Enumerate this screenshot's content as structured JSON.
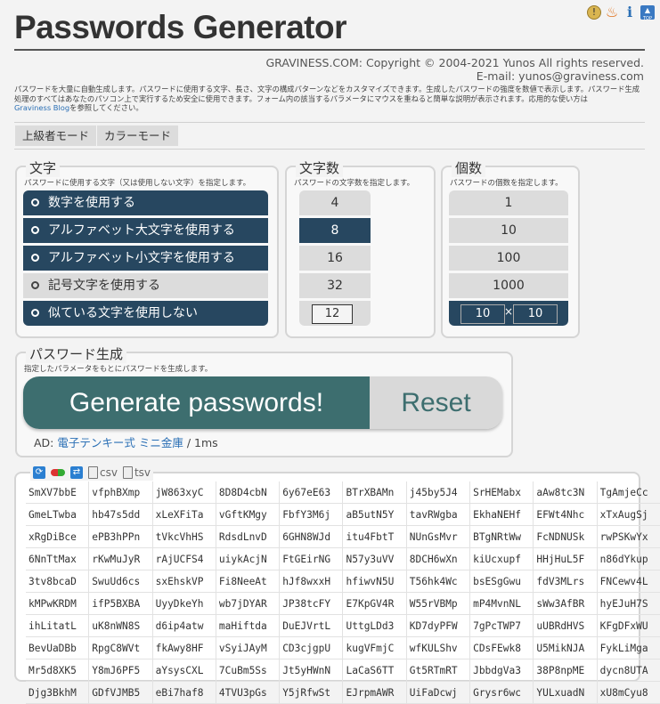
{
  "header": {
    "title": "Passwords Generator",
    "copyright": "GRAVINESS.COM: Copyright © 2004-2021 Yunos All rights reserved.",
    "email": "E-mail: yunos@graviness.com",
    "icons": [
      "warning-icon",
      "fire-icon",
      "info-icon",
      "top-icon"
    ],
    "top_icon_label": "TOP"
  },
  "description": {
    "text": "パスワードを大量に自動生成します。パスワードに使用する文字、長さ、文字の構成パターンなどをカスタマイズできます。生成したパスワードの強度を数値で表示します。パスワード生成処理のすべてはあなたのパソコン上で実行するため安全に使用できます。フォーム内の該当するパラメータにマウスを重ねると簡単な説明が表示されます。応用的な使い方は",
    "link": "Graviness Blog",
    "text_after": "を参照してください。"
  },
  "modes": [
    "上級者モード",
    "カラーモード"
  ],
  "chars_panel": {
    "legend": "文字",
    "sub": "パスワードに使用する文字（又は使用しない文字）を指定します。",
    "options": [
      {
        "label": "数字を使用する",
        "on": true
      },
      {
        "label": "アルファベット大文字を使用する",
        "on": true
      },
      {
        "label": "アルファベット小文字を使用する",
        "on": true
      },
      {
        "label": "記号文字を使用する",
        "on": false
      },
      {
        "label": "似ている文字を使用しない",
        "on": true
      }
    ]
  },
  "length_panel": {
    "legend": "文字数",
    "sub": "パスワードの文字数を指定します。",
    "options": [
      "4",
      "8",
      "16",
      "32"
    ],
    "selected": "8",
    "custom": "12"
  },
  "count_panel": {
    "legend": "個数",
    "sub": "パスワードの個数を指定します。",
    "options": [
      "1",
      "10",
      "100",
      "1000"
    ],
    "custom_a": "10",
    "times": "×",
    "custom_b": "10"
  },
  "generate_panel": {
    "legend": "パスワード生成",
    "sub": "指定したパラメータをもとにパスワードを生成します。",
    "generate_label": "Generate passwords!",
    "reset_label": "Reset"
  },
  "ad": {
    "prefix": "AD: ",
    "link": "電子テンキー式 ミニ金庫",
    "suffix": " / 1ms"
  },
  "results": {
    "tools": {
      "csv": "csv",
      "tsv": "tsv"
    },
    "passwords": [
      [
        "SmXV7bbE",
        "vfphBXmp",
        "jW863xyC",
        "8D8D4cbN",
        "6y67eE63",
        "BTrXBAMn",
        "j45by5J4",
        "SrHEMabx",
        "aAw8tc3N",
        "TgAmjeCc"
      ],
      [
        "GmeLTwba",
        "hb47s5dd",
        "xLeXFiTa",
        "vGftKMgy",
        "FbfY3M6j",
        "aB5utN5Y",
        "tavRWgba",
        "EkhaNEHf",
        "EFWt4Nhc",
        "xTxAugSj"
      ],
      [
        "xRgDiBce",
        "ePB3hPPn",
        "tVkcVhHS",
        "RdsdLnvD",
        "6GHN8WJd",
        "itu4FbtT",
        "NUnGsMvr",
        "BTgNRtWw",
        "FcNDNUSk",
        "rwPSKwYx"
      ],
      [
        "6NnTtMax",
        "rKwMuJyR",
        "rAjUCFS4",
        "uiykAcjN",
        "FtGEirNG",
        "N57y3uVV",
        "8DCH6wXn",
        "kiUcxupf",
        "HHjHuL5F",
        "n86dYkup"
      ],
      [
        "3tv8bcaD",
        "SwuUd6cs",
        "sxEhskVP",
        "Fi8NeeAt",
        "hJf8wxxH",
        "hfiwvN5U",
        "T56hk4Wc",
        "bsESgGwu",
        "fdV3MLrs",
        "FNCewv4L"
      ],
      [
        "kMPwKRDM",
        "ifP5BXBA",
        "UyyDkeYh",
        "wb7jDYAR",
        "JP38tcFY",
        "E7KpGV4R",
        "W55rVBMp",
        "mP4MvnNL",
        "sWw3AfBR",
        "hyEJuH7S"
      ],
      [
        "ihLitatL",
        "uK8nWN8S",
        "d6ip4atw",
        "maHiftda",
        "DuEJVrtL",
        "UttgLDd3",
        "KD7dyPFW",
        "7gPcTWP7",
        "uUBRdHVS",
        "KFgDFxWU"
      ],
      [
        "BevUaDBb",
        "RpgC8WVt",
        "fkAwy8HF",
        "vSyiJAyM",
        "CD3cjgpU",
        "kugVFmjC",
        "wfKULShv",
        "CDsFEwk8",
        "U5MikNJA",
        "FykLiMga"
      ],
      [
        "Mr5d8XK5",
        "Y8mJ6PF5",
        "aYsysCXL",
        "7CuBm5Ss",
        "Jt5yHWnN",
        "LaCaS6TT",
        "Gt5RTmRT",
        "JbbdgVa3",
        "38P8npME",
        "dycn8UTA"
      ],
      [
        "Djg3BkhM",
        "GDfVJMB5",
        "eBi7haf8",
        "4TVU3pGs",
        "Y5jRfwSt",
        "EJrpmAWR",
        "UiFaDcwj",
        "Grysr6wc",
        "YULxuadN",
        "xU8mCyu8"
      ]
    ]
  }
}
